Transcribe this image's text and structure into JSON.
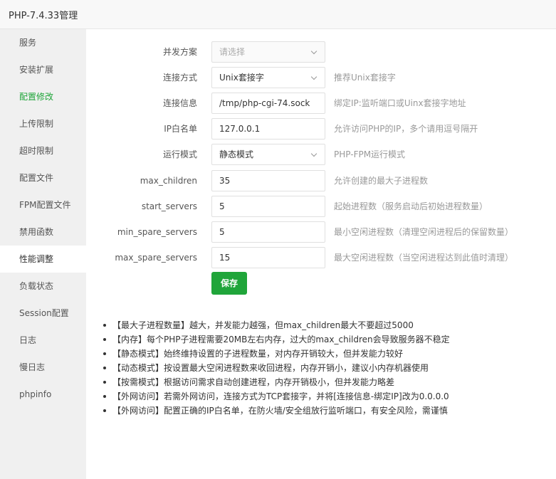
{
  "window": {
    "title": "PHP-7.4.33管理"
  },
  "sidebar": {
    "items": [
      {
        "label": "服务"
      },
      {
        "label": "安装扩展"
      },
      {
        "label": "配置修改"
      },
      {
        "label": "上传限制"
      },
      {
        "label": "超时限制"
      },
      {
        "label": "配置文件"
      },
      {
        "label": "FPM配置文件"
      },
      {
        "label": "禁用函数"
      },
      {
        "label": "性能调整"
      },
      {
        "label": "负载状态"
      },
      {
        "label": "Session配置"
      },
      {
        "label": "日志"
      },
      {
        "label": "慢日志"
      },
      {
        "label": "phpinfo"
      }
    ],
    "highlighted_index": 2,
    "selected_index": 8
  },
  "form": {
    "concurrency": {
      "label": "并发方案",
      "placeholder": "请选择"
    },
    "connection_mode": {
      "label": "连接方式",
      "value": "Unix套接字",
      "hint": "推荐Unix套接字"
    },
    "connection_info": {
      "label": "连接信息",
      "value": "/tmp/php-cgi-74.sock",
      "hint": "绑定IP:监听端口或Uinx套接字地址"
    },
    "ip_whitelist": {
      "label": "IP白名单",
      "value": "127.0.0.1",
      "hint": "允许访问PHP的IP，多个请用逗号隔开"
    },
    "run_mode": {
      "label": "运行模式",
      "value": "静态模式",
      "hint": "PHP-FPM运行模式"
    },
    "max_children": {
      "label": "max_children",
      "value": "35",
      "hint": "允许创建的最大子进程数"
    },
    "start_servers": {
      "label": "start_servers",
      "value": "5",
      "hint": "起始进程数（服务启动后初始进程数量）"
    },
    "min_spare_servers": {
      "label": "min_spare_servers",
      "value": "5",
      "hint": "最小空闲进程数（清理空闲进程后的保留数量）"
    },
    "max_spare_servers": {
      "label": "max_spare_servers",
      "value": "15",
      "hint": "最大空闲进程数（当空闲进程达到此值时清理）"
    },
    "save_label": "保存"
  },
  "notes": [
    "【最大子进程数量】越大，并发能力越强，但max_children最大不要超过5000",
    "【内存】每个PHP子进程需要20MB左右内存，过大的max_children会导致服务器不稳定",
    "【静态模式】始终维持设置的子进程数量，对内存开销较大，但并发能力较好",
    "【动态模式】按设置最大空闲进程数来收回进程，内存开销小，建议小内存机器使用",
    "【按需模式】根据访问需求自动创建进程，内存开销极小，但并发能力略差",
    "【外网访问】若需外网访问，连接方式为TCP套接字，并将[连接信息-绑定IP]改为0.0.0.0",
    "【外网访问】配置正确的IP白名单，在防火墙/安全组放行监听端口，有安全风险，需谨慎"
  ],
  "colors": {
    "accent": "#20a53a",
    "sidebar_bg": "#f0f0f0"
  }
}
